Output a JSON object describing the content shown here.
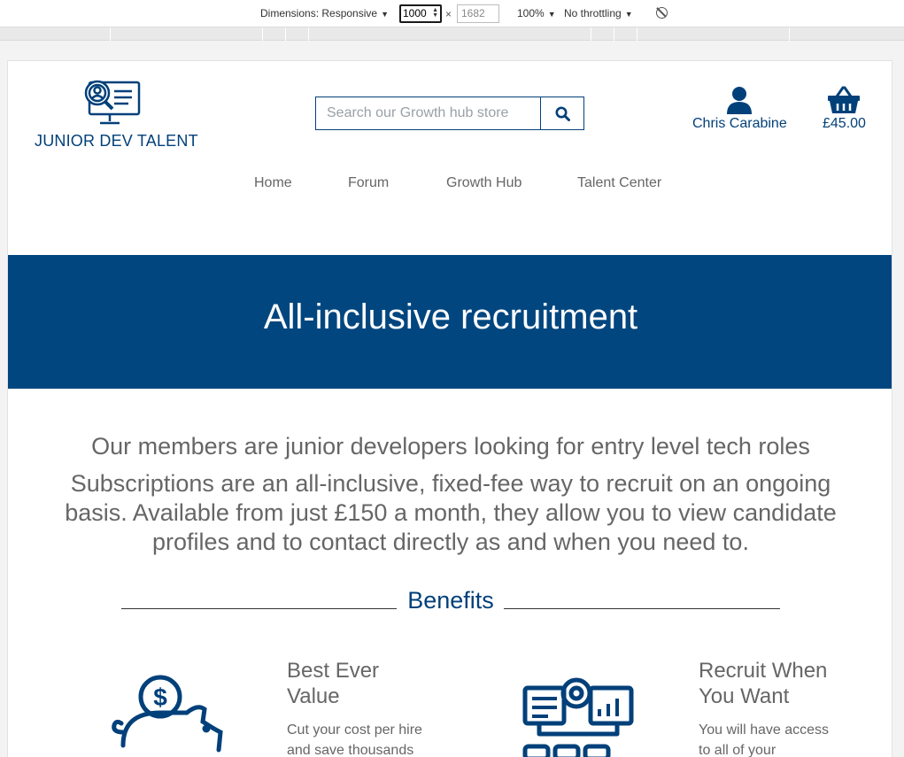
{
  "devtools": {
    "dimensions_label": "Dimensions: Responsive",
    "width": "1000",
    "times": "×",
    "height": "1682",
    "zoom": "100%",
    "throttling": "No throttling"
  },
  "brand": {
    "name": "JUNIOR DEV TALENT"
  },
  "search": {
    "placeholder": "Search our Growth hub store"
  },
  "account": {
    "user_name": "Chris Carabine",
    "basket_total": "£45.00"
  },
  "nav": [
    "Home",
    "Forum",
    "Growth Hub",
    "Talent Center"
  ],
  "banner": {
    "title": "All-inclusive recruitment"
  },
  "intro": {
    "headline": "Our members are junior developers looking for entry level tech roles",
    "body": "Subscriptions are an all-inclusive, fixed-fee way to recruit on an ongoing basis. Available from just £150 a month, they allow you to view candidate profiles and to contact directly as and when you need to."
  },
  "benefits": {
    "title": "Benefits",
    "items": [
      {
        "title_line1": "Best Ever",
        "title_line2": "Value",
        "text_line1": "Cut your cost per hire",
        "text_line2": "and save thousands",
        "icon": "piggy-bank-icon"
      },
      {
        "title_line1": "Recruit When",
        "title_line2": "You Want",
        "text_line1": "You will have access",
        "text_line2": "to all of your",
        "icon": "recruitment-dashboard-icon"
      }
    ]
  },
  "colors": {
    "brand_blue": "#02407a",
    "banner_blue": "#02467f"
  }
}
